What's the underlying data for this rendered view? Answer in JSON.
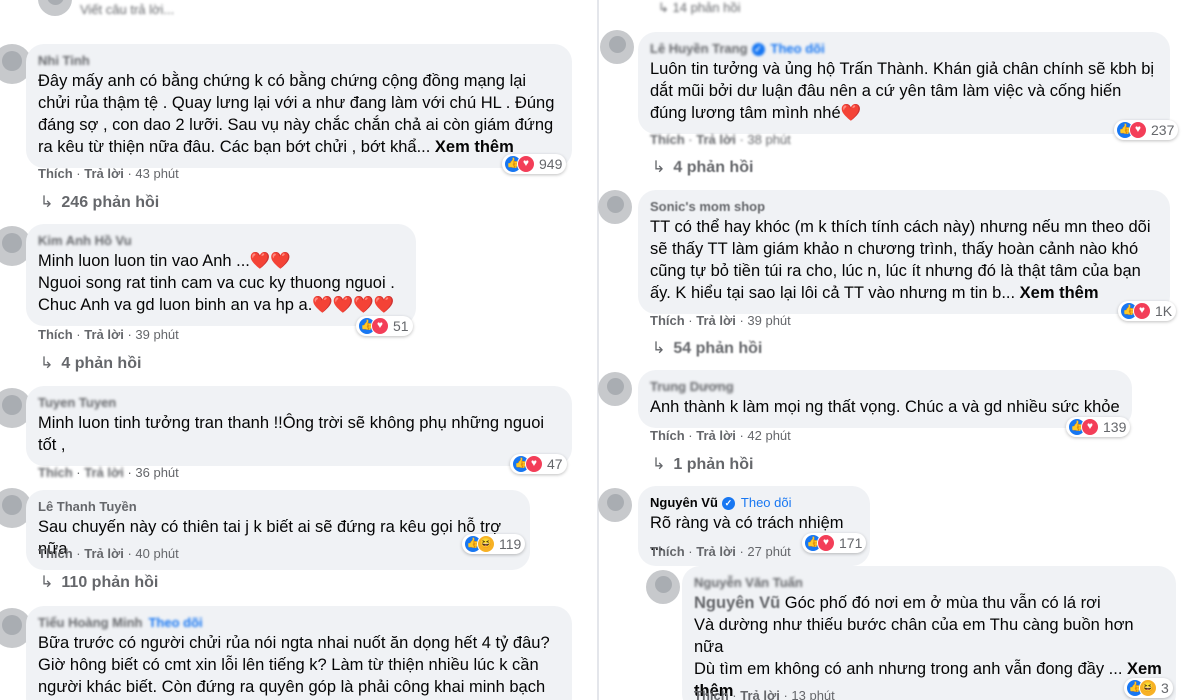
{
  "top_left": {
    "placeholder": "Viết câu trả lời..."
  },
  "top_right": {
    "replies": "14 phản hồi"
  },
  "left": [
    {
      "name": "Nhi Tinh",
      "text": "Đây mấy anh có bằng chứng k có bằng chứng cộng đồng mạng lại chửi rủa thậm tệ . Quay lưng lại với a như đang làm với chú HL . Đúng đáng sợ , con dao 2 lưỡi. Sau vụ này chắc chắn chả ai còn giám đứng ra kêu từ thiện nữa đâu. Các bạn bớt chửi , bớt khẩ... ",
      "more": "Xem thêm",
      "like": "Thích",
      "reply": "Trả lời",
      "time": "43 phút",
      "count": "949",
      "replies": "246 phản hồi"
    },
    {
      "name": "Kim Anh Hồ Vu",
      "text": "Minh luon luon tin vao Anh ...❤️❤️\nNguoi song rat tinh cam va cuc ky thuong nguoi .\nChuc Anh va gd luon binh an va hp a.❤️❤️❤️❤️",
      "more": "",
      "like": "Thích",
      "reply": "Trả lời",
      "time": "39 phút",
      "count": "51",
      "replies": "4 phản hồi"
    },
    {
      "name": "Tuyen Tuyen",
      "text": "Minh luon tinh tưởng tran thanh !!Ông trời sẽ không phụ những nguoi tốt ,",
      "more": "",
      "like": "Thích",
      "reply": "Trả lời",
      "time": "36 phút",
      "count": "47",
      "replies": ""
    },
    {
      "name": "Lê Thanh Tuyền",
      "text": "Sau chuyến này có thiên tai j k biết ai sẽ đứng ra kêu gọi hỗ trợ nữa",
      "more": "",
      "like": "Thích",
      "reply": "Trả lời",
      "time": "40 phút",
      "count": "119",
      "replies": "110 phản hồi"
    },
    {
      "name": "Tiểu Hoàng Minh",
      "follow": "Theo dõi",
      "text": "Bữa trước có người chửi rủa nói ngta nhai nuốt ăn dọng hết 4 tỷ đâu? Giờ hông biết có cmt xin lỗi lên tiếng k? Làm từ thiện nhiều lúc k cần người khác biết. Còn đứng ra quyên góp là phải công khai minh bạch",
      "more": "",
      "like": "",
      "reply": "",
      "time": "",
      "count": "",
      "replies": ""
    }
  ],
  "right": [
    {
      "name": "Lê Huyền Trang",
      "follow": "Theo dõi",
      "text": "Luôn tin tưởng và ủng hộ Trấn Thành. Khán giả chân chính sẽ kbh bị dắt mũi bởi dư luận đâu nên a cứ yên tâm làm việc và cống hiến đúng lương tâm mình nhé❤️",
      "more": "",
      "like": "Thích",
      "reply": "Trả lời",
      "time": "38 phút",
      "count": "237",
      "replies": "4 phản hồi"
    },
    {
      "name": "Sonic's mom shop",
      "text": "TT có thể hay khóc (m k thích tính cách này) nhưng nếu mn theo dõi sẽ thấy TT làm giám khảo n chương trình, thấy hoàn cảnh nào khó cũng tự bỏ tiền túi ra cho, lúc n, lúc ít nhưng đó là thật tâm của bạn ấy. K hiểu tại sao lại lôi cả TT vào nhưng m tin b... ",
      "more": "Xem thêm",
      "like": "Thích",
      "reply": "Trả lời",
      "time": "39 phút",
      "count": "1K",
      "replies": "54 phản hồi"
    },
    {
      "name": "Trung Dương",
      "text": "Anh thành k làm mọi ng thất vọng. Chúc a và gd nhiều sức khỏe",
      "more": "",
      "like": "Thích",
      "reply": "Trả lời",
      "time": "42 phút",
      "count": "139",
      "replies": "1 phản hồi"
    },
    {
      "name": "Nguyên Vũ",
      "follow": "Theo dõi",
      "text": "Rõ ràng và có trách nhiệm ...",
      "more": "",
      "like": "Thích",
      "reply": "Trả lời",
      "time": "27 phút",
      "count": "171",
      "replies": ""
    },
    {
      "name": "Nguyễn Văn Tuấn",
      "tag": "Nguyên Vũ",
      "text": " Góc phố đó nơi em ở mùa thu vẫn có lá rơi\nVà dường như thiếu bước chân của em Thu càng buồn hơn nữa\nDù tìm em không có anh nhưng trong anh vẫn đong đầy ... ",
      "more": "Xem thêm",
      "like": "Thích",
      "reply": "Trả lời",
      "time": "13 phút",
      "count": "3",
      "replies": ""
    }
  ]
}
